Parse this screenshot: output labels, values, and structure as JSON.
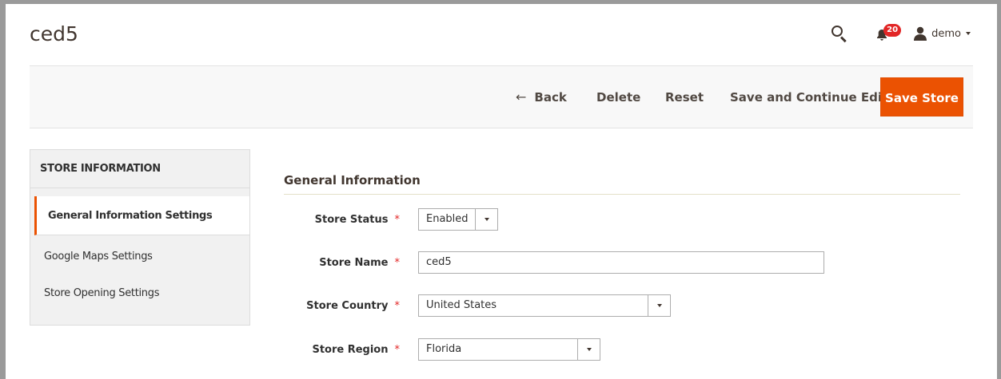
{
  "header": {
    "page_title": "ced5",
    "notification_count": "20",
    "user_name": "demo"
  },
  "toolbar": {
    "back_label": "Back",
    "delete_label": "Delete",
    "reset_label": "Reset",
    "save_continue_label": "Save and Continue Edit",
    "save_store_label": "Save Store"
  },
  "sidebar": {
    "title": "STORE INFORMATION",
    "items": [
      {
        "label": "General Information Settings",
        "active": true
      },
      {
        "label": "Google Maps Settings",
        "active": false
      },
      {
        "label": "Store Opening Settings",
        "active": false
      }
    ]
  },
  "form": {
    "section_title": "General Information",
    "required_marker": "*",
    "fields": {
      "store_status": {
        "label": "Store Status",
        "value": "Enabled"
      },
      "store_name": {
        "label": "Store Name",
        "value": "ced5"
      },
      "store_country": {
        "label": "Store Country",
        "value": "United States"
      },
      "store_region": {
        "label": "Store Region",
        "value": "Florida"
      }
    }
  },
  "colors": {
    "accent": "#eb5202",
    "badge": "#e22626",
    "required": "#e22626",
    "text_dark": "#41362f"
  },
  "icons": [
    "search-icon",
    "bell-icon",
    "user-icon",
    "chevron-down-icon",
    "back-arrow-icon"
  ]
}
